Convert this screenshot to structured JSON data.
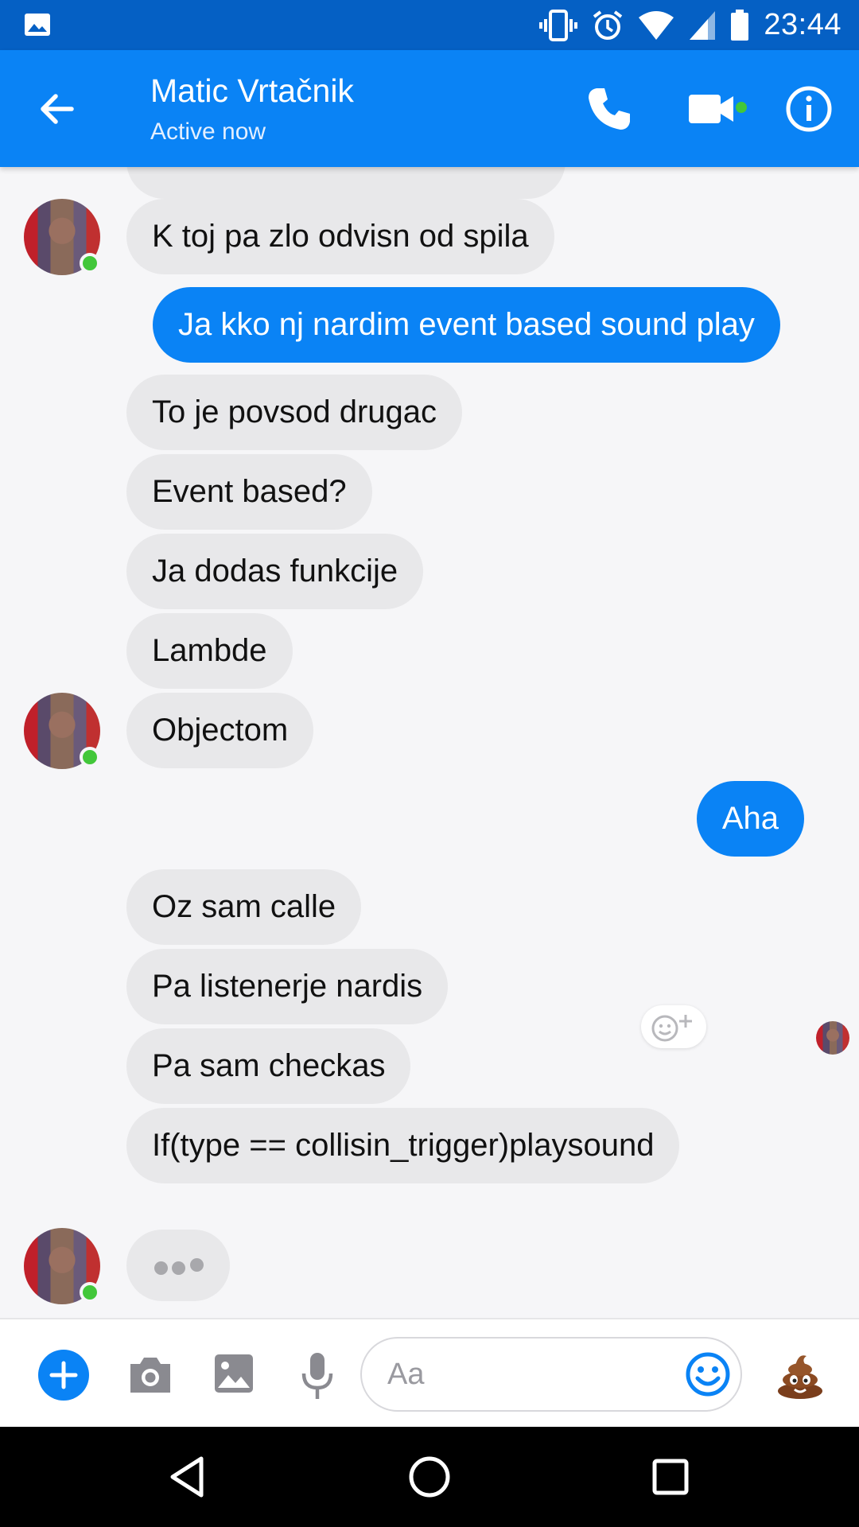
{
  "status_bar": {
    "time": "23:44",
    "icons": [
      "gallery-icon",
      "vibrate-icon",
      "alarm-icon",
      "wifi-icon",
      "signal-icon",
      "battery-icon"
    ]
  },
  "header": {
    "title": "Matic Vrtačnik",
    "subtitle": "Active now",
    "icons": [
      "back-arrow-icon",
      "phone-icon",
      "video-camera-icon",
      "info-icon"
    ],
    "video_active_color": "#42c73a",
    "accent_color": "#0a83f5"
  },
  "messages": [
    {
      "side": "in",
      "text": "K toj pa zlo odvisn od spila"
    },
    {
      "side": "out",
      "text": "Ja kko nj nardim event based sound play"
    },
    {
      "side": "in",
      "text": "To je povsod drugac"
    },
    {
      "side": "in",
      "text": "Event based?"
    },
    {
      "side": "in",
      "text": "Ja dodas funkcije"
    },
    {
      "side": "in",
      "text": "Lambde"
    },
    {
      "side": "in",
      "text": "Objectom"
    },
    {
      "side": "out",
      "text": "Aha"
    },
    {
      "side": "in",
      "text": "Oz sam calle"
    },
    {
      "side": "in",
      "text": "Pa listenerje nardis"
    },
    {
      "side": "in",
      "text": "Pa sam checkas"
    },
    {
      "side": "in",
      "text": "If(type == collisin_trigger)playsound"
    }
  ],
  "composer": {
    "placeholder": "Aa",
    "icons": [
      "add-icon",
      "camera-icon",
      "image-icon",
      "microphone-icon",
      "emoji-icon",
      "poop-emoji-icon"
    ]
  },
  "nav_bar": {
    "icons": [
      "back-triangle-icon",
      "home-circle-icon",
      "recents-square-icon"
    ]
  }
}
